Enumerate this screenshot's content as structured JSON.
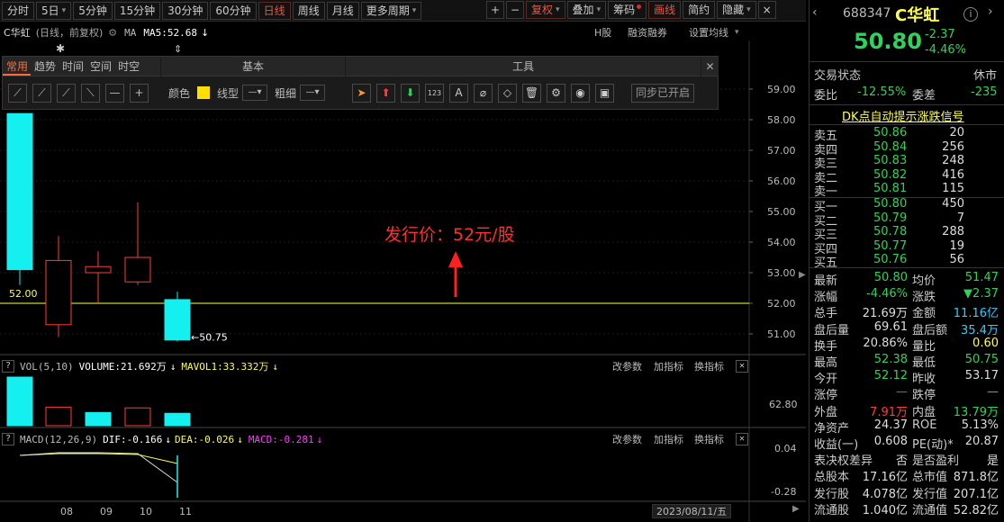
{
  "toolbar": {
    "periods": [
      "分时",
      "5日",
      "5分钟",
      "15分钟",
      "30分钟",
      "60分钟",
      "日线",
      "周线",
      "月线",
      "更多周期"
    ],
    "active_period": "日线",
    "right_buttons": [
      "复权",
      "叠加",
      "筹码",
      "画线",
      "简约",
      "隐藏"
    ],
    "plus": "+",
    "minus": "−",
    "close": "×"
  },
  "chart_header": {
    "title": "C华虹",
    "mode": "(日线，前复权)",
    "ma_label": "MA",
    "ma5": "MA5:52.68",
    "h_share": "H股",
    "margin": "融资融券",
    "set_ma": "设置均线"
  },
  "drawing_panel": {
    "tabs": [
      "常用",
      "趋势",
      "时间",
      "空间",
      "时空"
    ],
    "basic_label": "基本",
    "tools_label": "工具",
    "color_label": "颜色",
    "line_type_label": "线型",
    "thickness_label": "粗细",
    "sync_label": "同步已开启",
    "color_value": "#ffe000",
    "line_icons": [
      "line-icon",
      "ray-icon",
      "segment-icon",
      "arrow-line-icon",
      "hline-icon",
      "cross-icon"
    ],
    "tool_icons": [
      "pointer-icon",
      "up-arrow-icon",
      "down-arrow-icon",
      "number-icon",
      "text-icon",
      "eraser-icon",
      "rubber-icon",
      "trash-icon",
      "gear-icon",
      "eye-icon",
      "image-icon"
    ],
    "tool_glyphs": [
      "➤",
      "⬆",
      "⬇",
      "123",
      "A",
      "⌀",
      "◇",
      "🗑",
      "⚙",
      "◉",
      "▣"
    ],
    "line_glyphs": [
      "⟋",
      "⟋",
      "⟋",
      "⟍",
      "—",
      "+"
    ]
  },
  "annotation": {
    "text": "发行价：52元/股"
  },
  "chart_data": {
    "type": "candlestick",
    "price_axis": [
      "59.00",
      "58.00",
      "57.00",
      "56.00",
      "55.00",
      "54.00",
      "53.00",
      "52.00",
      "51.00"
    ],
    "ylim": [
      50.6,
      59.3
    ],
    "x_ticks": [
      "08",
      "09",
      "10",
      "11"
    ],
    "candles": [
      {
        "open": 58.2,
        "close": 53.1,
        "high": 58.2,
        "low": 52.6
      },
      {
        "open": 51.3,
        "close": 53.4,
        "high": 54.2,
        "low": 50.9
      },
      {
        "open": 53.0,
        "close": 53.2,
        "high": 53.7,
        "low": 52.0
      },
      {
        "open": 52.7,
        "close": 53.5,
        "high": 55.3,
        "low": 52.6
      },
      {
        "open": 52.12,
        "close": 50.8,
        "high": 52.38,
        "low": 50.75
      }
    ],
    "up_color": "#ff3c3c",
    "down_color": "#14f0f0",
    "hline_value": 52.0,
    "low_label": "52.00",
    "low_mark": "50.75",
    "volume": [
      62.8,
      24.0,
      17.0,
      23.0,
      16.0
    ],
    "volume_up": [
      false,
      true,
      false,
      true,
      false
    ],
    "volume_axis": "62.80",
    "macd_axis": [
      "0.04",
      "-0.28"
    ],
    "date_label": "2023/08/11/五"
  },
  "vol_header": {
    "label": "VOL(5,10)",
    "volume": "VOLUME:21.692万",
    "mavol": "MAVOL1:33.332万",
    "params": "改参数",
    "add": "加指标",
    "switch": "换指标"
  },
  "macd_header": {
    "label": "MACD(12,26,9)",
    "dif": "DIF:-0.166",
    "dea": "DEA:-0.026",
    "macd": "MACD:-0.281",
    "params": "改参数",
    "add": "加指标",
    "switch": "换指标"
  },
  "quote": {
    "code": "688347",
    "name": "C华虹",
    "price": "50.80",
    "change": "-2.37",
    "change_pct": "-4.46%",
    "status_label": "交易状态",
    "status": "休市",
    "weibi_label": "委比",
    "weibi": "-12.55%",
    "weicha_label": "委差",
    "weicha": "-235",
    "dk_label": "DK点自动提示涨跌信号",
    "asks": [
      {
        "label": "卖五",
        "price": "50.86",
        "vol": "20"
      },
      {
        "label": "卖四",
        "price": "50.84",
        "vol": "256"
      },
      {
        "label": "卖三",
        "price": "50.83",
        "vol": "248"
      },
      {
        "label": "卖二",
        "price": "50.82",
        "vol": "416"
      },
      {
        "label": "卖一",
        "price": "50.81",
        "vol": "115"
      }
    ],
    "bids": [
      {
        "label": "买一",
        "price": "50.80",
        "vol": "450"
      },
      {
        "label": "买二",
        "price": "50.79",
        "vol": "7"
      },
      {
        "label": "买三",
        "price": "50.78",
        "vol": "288"
      },
      {
        "label": "买四",
        "price": "50.77",
        "vol": "19"
      },
      {
        "label": "买五",
        "price": "50.76",
        "vol": "56"
      }
    ],
    "stats": [
      {
        "l1": "最新",
        "v1": "50.80",
        "c1": "green",
        "l2": "均价",
        "v2": "51.47",
        "c2": "green"
      },
      {
        "l1": "涨幅",
        "v1": "-4.46%",
        "c1": "green",
        "l2": "涨跌",
        "v2": "▼2.37",
        "c2": "green"
      },
      {
        "l1": "总手",
        "v1": "21.69万",
        "c1": "white",
        "l2": "金额",
        "v2": "11.16亿",
        "c2": "cyan"
      },
      {
        "l1": "盘后量",
        "v1": "69.61",
        "c1": "white",
        "l2": "盘后额",
        "v2": "35.4万",
        "c2": "cyan"
      },
      {
        "l1": "换手",
        "v1": "20.86%",
        "c1": "white",
        "l2": "量比",
        "v2": "0.60",
        "c2": "yellow"
      },
      {
        "l1": "最高",
        "v1": "52.38",
        "c1": "green",
        "l2": "最低",
        "v2": "50.75",
        "c2": "green"
      },
      {
        "l1": "今开",
        "v1": "52.12",
        "c1": "green",
        "l2": "昨收",
        "v2": "53.17",
        "c2": "white"
      },
      {
        "l1": "涨停",
        "v1": "—",
        "c1": "red",
        "l2": "跌停",
        "v2": "—",
        "c2": "green"
      },
      {
        "l1": "外盘",
        "v1": "7.91万",
        "c1": "red",
        "l2": "内盘",
        "v2": "13.79万",
        "c2": "green"
      },
      {
        "l1": "净资产",
        "v1": "24.37",
        "c1": "white",
        "l2": "ROE",
        "v2": "5.13%",
        "c2": "white"
      },
      {
        "l1": "收益(一)",
        "v1": "0.608",
        "c1": "white",
        "l2": "PE(动)*",
        "v2": "20.87",
        "c2": "white"
      },
      {
        "l1": "表决权差异",
        "v1": "否",
        "c1": "white",
        "l2": "是否盈利",
        "v2": "是",
        "c2": "white"
      },
      {
        "l1": "总股本",
        "v1": "17.16亿",
        "c1": "white",
        "l2": "总市值",
        "v2": "871.8亿",
        "c2": "white"
      },
      {
        "l1": "发行股",
        "v1": "4.078亿",
        "c1": "white",
        "l2": "发行值",
        "v2": "207.1亿",
        "c2": "white"
      },
      {
        "l1": "流通股",
        "v1": "1.040亿",
        "c1": "white",
        "l2": "流通值",
        "v2": "52.82亿",
        "c2": "white"
      }
    ]
  }
}
